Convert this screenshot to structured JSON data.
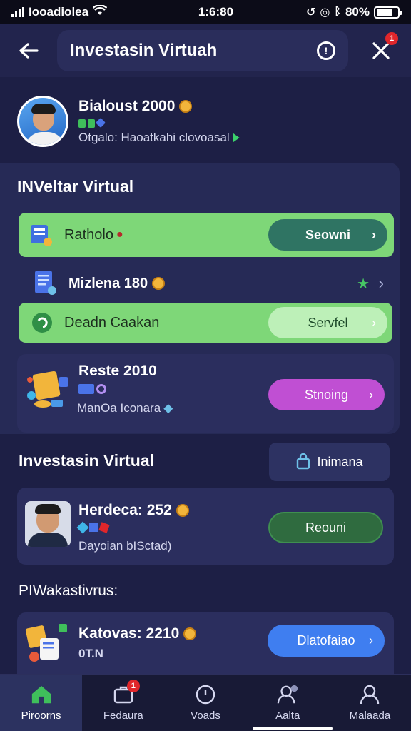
{
  "status_bar": {
    "carrier": "Iooadiolea",
    "time": "1:6:80",
    "battery": "80%",
    "battery_level": 0.8
  },
  "header": {
    "title": "Investasin Virtuah",
    "notification_count": "1"
  },
  "profile": {
    "name": "Bialoust 2000",
    "subtitle": "Otgalo: Haoatkahi clovoasal"
  },
  "section1": {
    "title": "INVeltar Virtual",
    "row1": {
      "label": "Ratholo",
      "button": "Seowni"
    },
    "row2": {
      "label": "Mizlena 180"
    },
    "row3": {
      "label": "Deadn Caakan",
      "button": "Servfel"
    },
    "card1": {
      "name": "Reste 2010",
      "subtitle": "ManOa Iconara",
      "button": "Stnoing"
    }
  },
  "section2": {
    "title": "Investasin Virtual",
    "header_button": "Inimana",
    "card1": {
      "name": "Herdeca: 252",
      "subtitle": "Dayoian bISctad)",
      "button": "Reouni"
    }
  },
  "section3": {
    "title": "PIWakastivrus:",
    "card1": {
      "name": "Katovas: 2210",
      "subtitle": "0T.N",
      "button": "Dlatofaiao"
    }
  },
  "bottom_nav": [
    {
      "label": "Piroorns",
      "icon": "home-icon",
      "active": true
    },
    {
      "label": "Fedaura",
      "icon": "briefcase-icon",
      "badge": "1"
    },
    {
      "label": "Voads",
      "icon": "clock-icon"
    },
    {
      "label": "Aalta",
      "icon": "user-icon"
    },
    {
      "label": "Malaada",
      "icon": "profile-icon"
    }
  ],
  "colors": {
    "background": "#1d1f45",
    "green_row": "#7ed778",
    "teal_button": "#2f7463",
    "purple_button": "#c04fd3",
    "dark_green_button": "#2f6b3f",
    "blue_button": "#3f7ef0",
    "badge": "#e0262b"
  }
}
